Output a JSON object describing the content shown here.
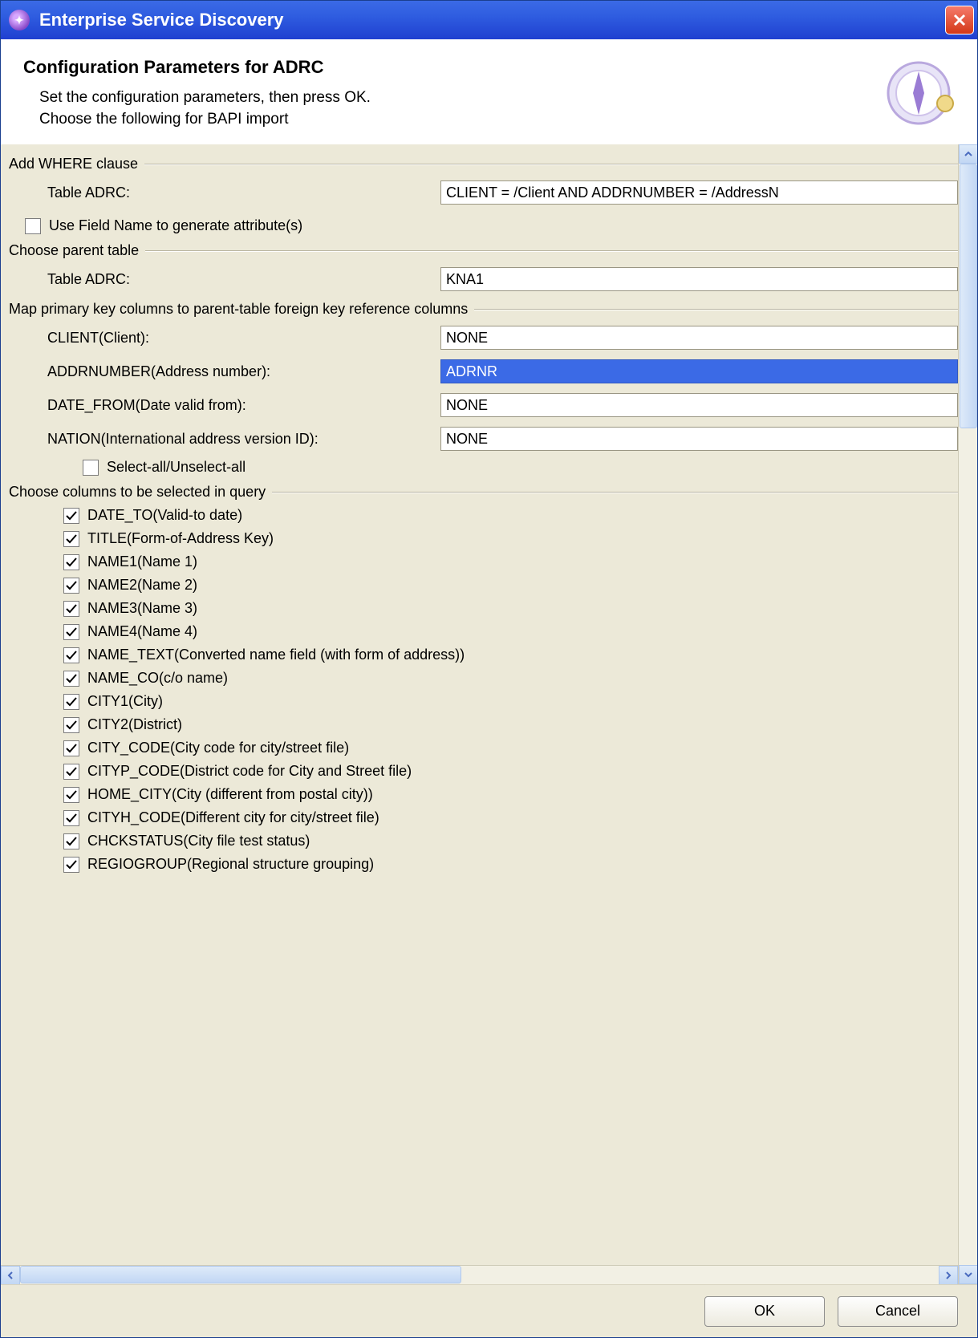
{
  "window": {
    "title": "Enterprise Service Discovery"
  },
  "header": {
    "title": "Configuration Parameters for ADRC",
    "desc1": "Set the configuration parameters, then press OK.",
    "desc2": "Choose the following for BAPI import"
  },
  "sections": {
    "where_clause": {
      "legend": "Add WHERE clause",
      "label": "Table ADRC:",
      "value": "CLIENT = /Client AND ADDRNUMBER = /AddressN"
    },
    "use_field_name": {
      "label": "Use Field Name to generate attribute(s)",
      "checked": false
    },
    "parent_table": {
      "legend": "Choose parent table",
      "label": "Table ADRC:",
      "value": "KNA1"
    },
    "key_mapping": {
      "legend": "Map primary key columns to parent-table foreign key reference columns",
      "rows": [
        {
          "label": "CLIENT(Client):",
          "value": "NONE",
          "selected": false
        },
        {
          "label": "ADDRNUMBER(Address number):",
          "value": "ADRNR",
          "selected": true
        },
        {
          "label": "DATE_FROM(Date valid from):",
          "value": "NONE",
          "selected": false
        },
        {
          "label": "NATION(International address version ID):",
          "value": "NONE",
          "selected": false
        }
      ],
      "select_all": {
        "label": "Select-all/Unselect-all",
        "checked": false
      }
    },
    "columns": {
      "legend": "Choose columns to be selected in query",
      "items": [
        {
          "label": "DATE_TO(Valid-to date)",
          "checked": true
        },
        {
          "label": "TITLE(Form-of-Address Key)",
          "checked": true
        },
        {
          "label": "NAME1(Name 1)",
          "checked": true
        },
        {
          "label": "NAME2(Name 2)",
          "checked": true
        },
        {
          "label": "NAME3(Name 3)",
          "checked": true
        },
        {
          "label": "NAME4(Name 4)",
          "checked": true
        },
        {
          "label": "NAME_TEXT(Converted name field (with form of address))",
          "checked": true
        },
        {
          "label": "NAME_CO(c/o name)",
          "checked": true
        },
        {
          "label": "CITY1(City)",
          "checked": true
        },
        {
          "label": "CITY2(District)",
          "checked": true
        },
        {
          "label": "CITY_CODE(City code for city/street file)",
          "checked": true
        },
        {
          "label": "CITYP_CODE(District code for City and Street file)",
          "checked": true
        },
        {
          "label": "HOME_CITY(City (different from postal city))",
          "checked": true
        },
        {
          "label": "CITYH_CODE(Different city for city/street file)",
          "checked": true
        },
        {
          "label": "CHCKSTATUS(City file test status)",
          "checked": true
        },
        {
          "label": "REGIOGROUP(Regional structure grouping)",
          "checked": true
        }
      ]
    }
  },
  "footer": {
    "ok": "OK",
    "cancel": "Cancel"
  }
}
